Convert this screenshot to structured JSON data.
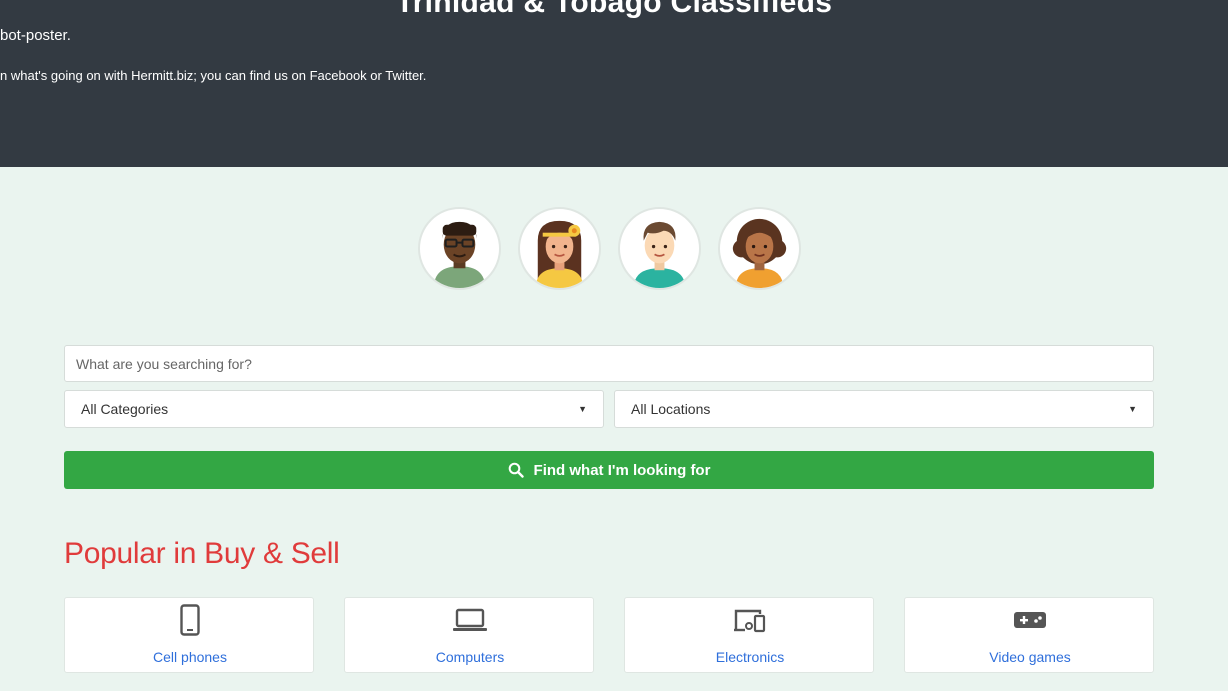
{
  "header": {
    "title": "Trinidad & Tobago Classifieds",
    "line1": "bot-poster.",
    "line2": "n what's going on with Hermitt.biz; you can find us on Facebook or Twitter."
  },
  "search": {
    "placeholder": "What are you searching for?",
    "category_selected": "All Categories",
    "location_selected": "All Locations",
    "button_label": "Find what I'm looking for"
  },
  "popular": {
    "title": "Popular in Buy & Sell",
    "items": [
      {
        "label": "Cell phones",
        "icon": "cell-phone-icon"
      },
      {
        "label": "Computers",
        "icon": "laptop-icon"
      },
      {
        "label": "Electronics",
        "icon": "devices-icon"
      },
      {
        "label": "Video games",
        "icon": "gamepad-icon"
      }
    ]
  },
  "colors": {
    "header_bg": "#333a42",
    "page_bg": "#eaf4ef",
    "button_green": "#33a744",
    "title_red": "#e03b3b",
    "link_blue": "#2f6fdb"
  }
}
